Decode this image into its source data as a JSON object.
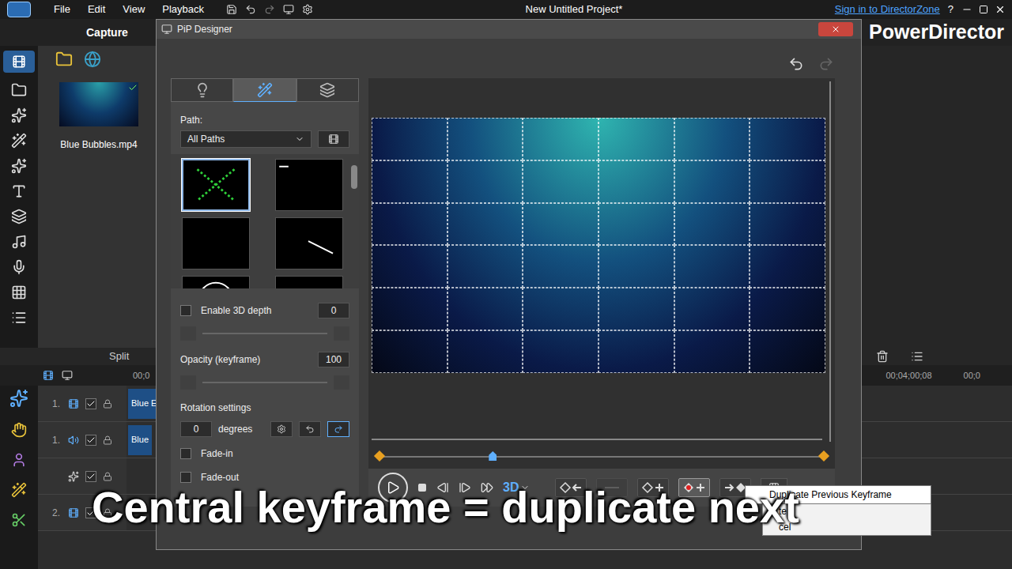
{
  "app": {
    "menu": [
      "File",
      "Edit",
      "View",
      "Playback"
    ],
    "title": "New Untitled Project*",
    "sign_in": "Sign in to DirectorZone",
    "help": "?",
    "mode_tab": "Capture",
    "brand": "PowerDirector"
  },
  "library": {
    "items": [
      {
        "label": "Blue Bubbles.mp4",
        "checked": true
      }
    ]
  },
  "timeline": {
    "split": "Split",
    "ruler": [
      "00;0",
      "00;04;00;08",
      "00;0"
    ],
    "tracks": [
      {
        "number": "1.",
        "kind": "video",
        "checked": true,
        "clip": "Blue E"
      },
      {
        "number": "1.",
        "kind": "audio",
        "checked": true,
        "clip": "Blue"
      },
      {
        "number": "",
        "kind": "effect",
        "checked": true,
        "clip": ""
      },
      {
        "number": "2.",
        "kind": "video",
        "checked": true,
        "clip": ""
      }
    ]
  },
  "dialog": {
    "title": "PiP Designer",
    "tabs": [
      {
        "kind": "properties",
        "selected": false
      },
      {
        "kind": "motion",
        "selected": true
      },
      {
        "kind": "mask",
        "selected": false
      }
    ],
    "path": {
      "label": "Path:",
      "value": "All Paths",
      "presets": [
        {
          "kind": "cross",
          "selected": true
        },
        {
          "kind": "dash",
          "selected": false
        },
        {
          "kind": "blank",
          "selected": false
        },
        {
          "kind": "diagonal",
          "selected": false
        },
        {
          "kind": "circle",
          "selected": false
        },
        {
          "kind": "blank",
          "selected": false
        }
      ]
    },
    "depth": {
      "label": "Enable 3D depth",
      "checked": false,
      "value": "0"
    },
    "opacity": {
      "label": "Opacity (keyframe)",
      "value": "100"
    },
    "rotation": {
      "label": "Rotation settings",
      "value": "0",
      "unit": "degrees"
    },
    "fades": [
      {
        "label": "Fade-in",
        "checked": false
      },
      {
        "label": "Fade-out",
        "checked": false
      }
    ],
    "scrubber": {
      "level": 0.255
    },
    "stereo": "3D",
    "keyframe_buttons": [
      {
        "kind": "previous",
        "disabled": false,
        "hovered": false
      },
      {
        "kind": "remove",
        "disabled": true,
        "hovered": false
      },
      {
        "kind": "add",
        "disabled": false,
        "hovered": false
      },
      {
        "kind": "duplicate-previous",
        "disabled": false,
        "hovered": true
      },
      {
        "kind": "duplicate-next",
        "disabled": false,
        "hovered": false
      }
    ],
    "tooltip": "Duplicate Previous Keyframe",
    "menu": [
      "te l",
      "cel"
    ]
  },
  "caption": "Central keyframe = duplicate next"
}
